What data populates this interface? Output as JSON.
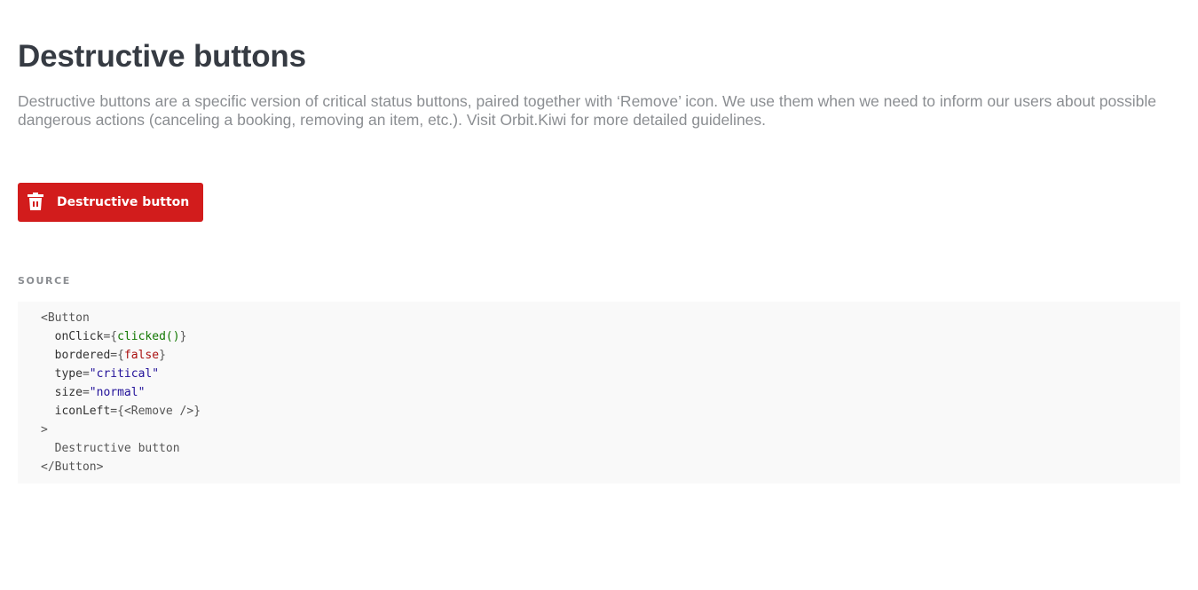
{
  "header": {
    "title": "Destructive buttons",
    "description": "Destructive buttons are a specific version of critical status buttons, paired together with ‘Remove’ icon. We use them when we need to inform our users about possible dangerous actions (canceling a booking, removing an item, etc.). Visit Orbit.Kiwi for more detailed guidelines."
  },
  "example": {
    "button_label": "Destructive button",
    "button_icon": "trash-icon",
    "button_color": "#d21c1c"
  },
  "source": {
    "label": "SOURCE",
    "lines": [
      {
        "t1": "<Button"
      },
      {
        "attr": "onClick",
        "eq": "={",
        "val": "clicked()",
        "close": "}"
      },
      {
        "attr": "bordered",
        "eq": "={",
        "val": "false",
        "close": "}"
      },
      {
        "attr": "type",
        "eq": "=",
        "val": "\"critical\"",
        "close": ""
      },
      {
        "attr": "size",
        "eq": "=",
        "val": "\"normal\"",
        "close": ""
      },
      {
        "attr": "iconLeft",
        "eq": "={",
        "val": "<Remove />",
        "close": "}"
      },
      {
        "t1": ">"
      },
      {
        "t1": "Destructive button"
      },
      {
        "t1": "</Button>"
      }
    ]
  }
}
